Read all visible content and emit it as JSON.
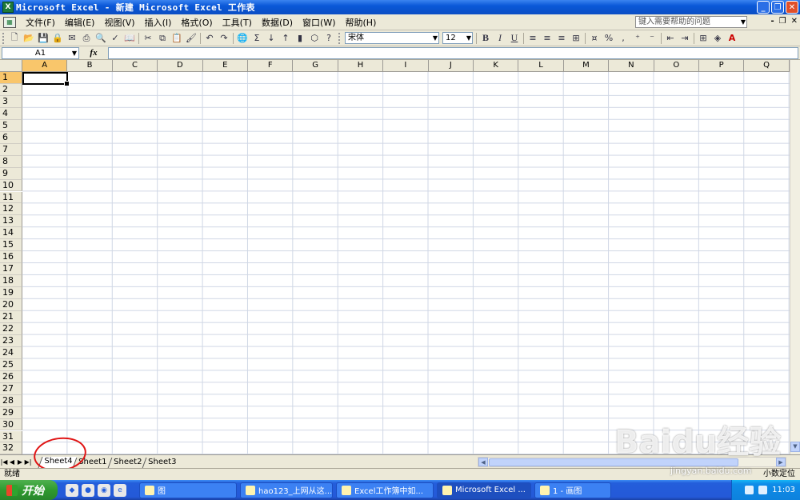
{
  "window": {
    "title": "Microsoft Excel - 新建 Microsoft Excel 工作表",
    "app_icon_label": "X",
    "minimize": "_",
    "restore": "❐",
    "close": "✕"
  },
  "menu": {
    "items": [
      "文件(F)",
      "编辑(E)",
      "视图(V)",
      "插入(I)",
      "格式(O)",
      "工具(T)",
      "数据(D)",
      "窗口(W)",
      "帮助(H)"
    ],
    "help_placeholder": "键入需要帮助的问题",
    "doc_min": "-",
    "doc_restore": "❐",
    "doc_close": "✕"
  },
  "toolbar": {
    "font_name": "宋体",
    "font_size": "12",
    "bold": "B",
    "italic": "I",
    "underline": "U",
    "sum": "Σ",
    "percent": "%"
  },
  "formula_bar": {
    "name_box": "A1",
    "fx": "fx",
    "value": ""
  },
  "grid": {
    "columns": [
      "A",
      "B",
      "C",
      "D",
      "E",
      "F",
      "G",
      "H",
      "I",
      "J",
      "K",
      "L",
      "M",
      "N",
      "O",
      "P",
      "Q"
    ],
    "rows": [
      "1",
      "2",
      "3",
      "4",
      "5",
      "6",
      "7",
      "8",
      "9",
      "10",
      "11",
      "12",
      "13",
      "14",
      "15",
      "16",
      "17",
      "18",
      "19",
      "20",
      "21",
      "22",
      "23",
      "24",
      "25",
      "26",
      "27",
      "28",
      "29",
      "30",
      "31",
      "32"
    ],
    "active_cell": "A1"
  },
  "sheets": {
    "tabs": [
      "Sheet4",
      "Sheet1",
      "Sheet2",
      "Sheet3"
    ],
    "active": "Sheet4"
  },
  "status": {
    "left": "就绪",
    "right": "小数定位"
  },
  "taskbar": {
    "start_label": "开始",
    "tasks": [
      {
        "label": "图",
        "active": false
      },
      {
        "label": "hao123_上网从这...",
        "active": false
      },
      {
        "label": "Excel工作簿中如...",
        "active": false
      },
      {
        "label": "Microsoft Excel ...",
        "active": true
      },
      {
        "label": "1 - 画图",
        "active": false
      }
    ],
    "clock": "11:03"
  },
  "watermark": {
    "text": "Baidu经验",
    "sub": "jingyan.baidu.com"
  },
  "colors": {
    "title_blue": "#0a58d8",
    "header_active": "#f9c66b",
    "annotation_red": "#e01414",
    "start_green": "#2f9a2f"
  }
}
